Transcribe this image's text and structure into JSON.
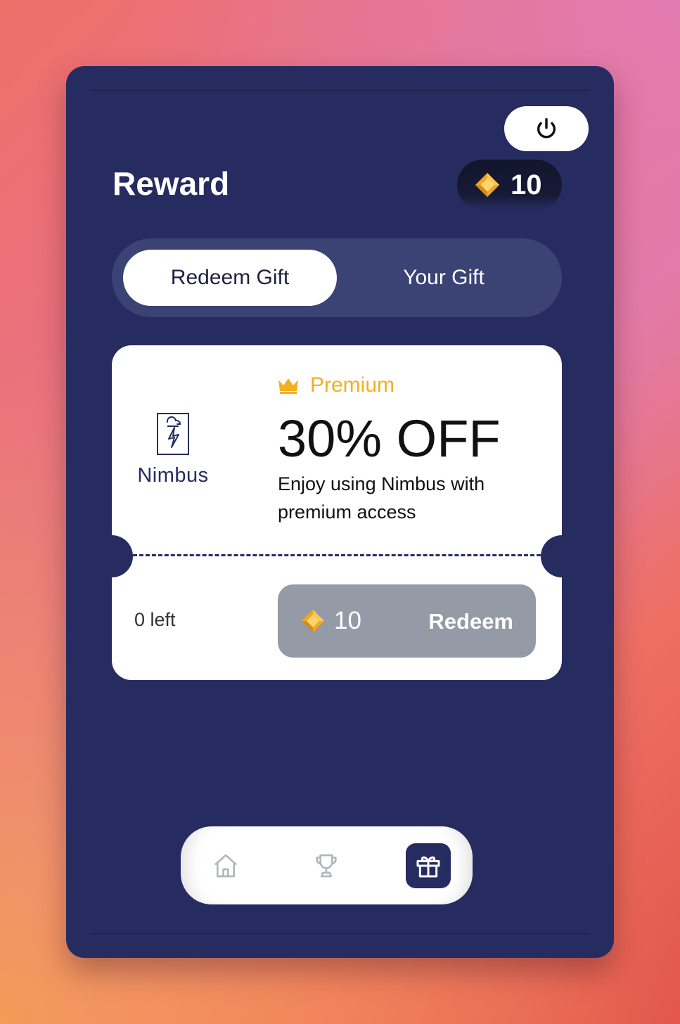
{
  "header": {
    "title": "Reward",
    "coin_balance": "10"
  },
  "tabs": [
    {
      "label": "Redeem Gift",
      "active": true
    },
    {
      "label": "Your Gift",
      "active": false
    }
  ],
  "offer_card": {
    "brand": "Nimbus",
    "tier": "Premium",
    "headline": "30% OFF",
    "description": "Enjoy using Nimbus with premium access",
    "remaining": "0 left",
    "cost": "10",
    "redeem_label": "Redeem"
  },
  "bottom_nav": {
    "items": [
      {
        "icon": "home-icon",
        "active": false
      },
      {
        "icon": "trophy-icon",
        "active": false
      },
      {
        "icon": "gift-icon",
        "active": true
      }
    ]
  },
  "colors": {
    "panel": "#262c60",
    "accent_gold": "#f0b021",
    "disabled_button": "#949aa6"
  }
}
